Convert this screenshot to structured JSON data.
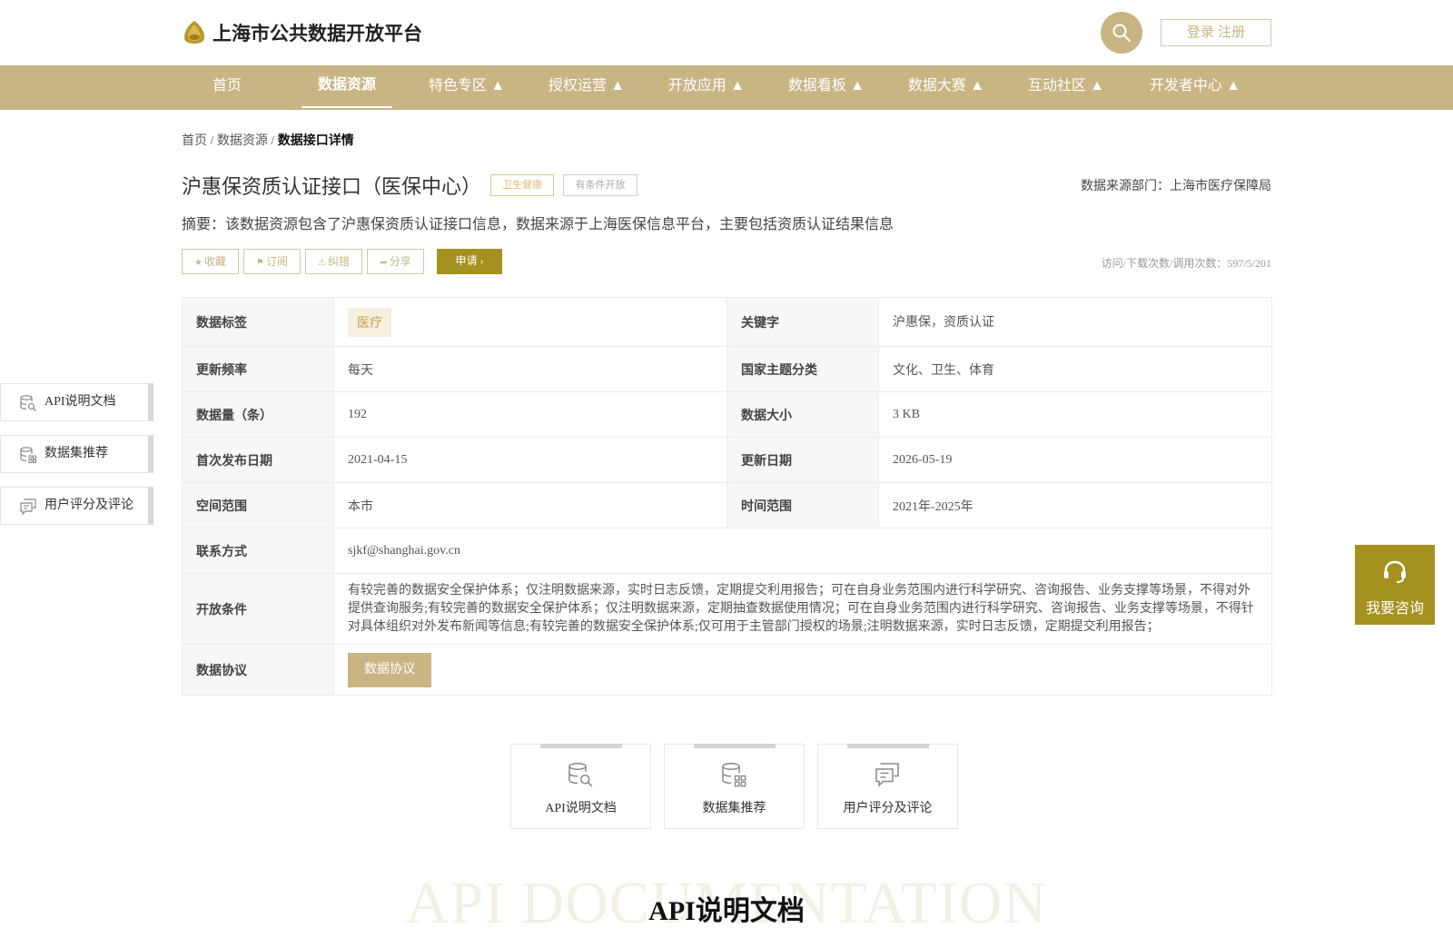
{
  "header": {
    "site_title": "上海市公共数据开放平台",
    "login_register": "登录 注册",
    "colors": {
      "accent": "#c9b484",
      "dark_accent": "#a5911f"
    }
  },
  "nav": [
    "首页",
    "数据资源",
    "特色专区 ▲",
    "授权运营 ▲",
    "开放应用 ▲",
    "数据看板 ▲",
    "数据大赛 ▲",
    "互动社区 ▲",
    "开发者中心 ▲"
  ],
  "breadcrumb": {
    "home": "首页",
    "sep1": " / ",
    "resource": "数据资源",
    "sep2": " / ",
    "current": "数据接口详情"
  },
  "detail": {
    "title": "沪惠保资质认证接口（医保中心）",
    "tag_category": "卫生健康",
    "tag_open_type": "有条件开放",
    "source": "数据来源部门：上海市医疗保障局",
    "summary": "摘要：该数据资源包含了沪惠保资质认证接口信息，数据来源于上海医保信息平台，主要包括资质认证结果信息",
    "actions": {
      "favorite": "收藏",
      "subscribe": "订阅",
      "report_error": "纠错",
      "share": "分享",
      "apply": "申请"
    },
    "visits": "访问/下载次数/调用次数：597/5/201"
  },
  "info": {
    "data_tag_label": "数据标签",
    "data_tag_value": "医疗",
    "keyword_label": "关键字",
    "keyword_value": "沪惠保，资质认证",
    "frequency_label": "更新频率",
    "frequency_value": "每天",
    "national_topic_label": "国家主题分类",
    "national_topic_value": "文化、卫生、体育",
    "volume_label": "数据量（条）",
    "volume_value": "192",
    "size_label": "数据大小",
    "size_value": "3 KB",
    "first_publish_label": "首次发布日期",
    "first_publish_value": "2021-04-15",
    "update_date_label": "更新日期",
    "update_date_value": "2026-05-19",
    "spatial_label": "空间范围",
    "spatial_value": "本市",
    "time_range_label": "时间范围",
    "time_range_value": "2021年-2025年",
    "contact_label": "联系方式",
    "contact_value": "sjkf@shanghai.gov.cn",
    "conditions_label": "开放条件",
    "conditions_value": "有较完善的数据安全保护体系；仅注明数据来源，实时日志反馈，定期提交利用报告；可在自身业务范围内进行科学研究、咨询报告、业务支撑等场景，不得对外提供查询服务;有较完善的数据安全保护体系；仅注明数据来源，定期抽查数据使用情况；可在自身业务范围内进行科学研究、咨询报告、业务支撑等场景，不得针对具体组织对外发布新闻等信息;有较完善的数据安全保护体系;仅可用于主管部门授权的场景;注明数据来源，实时日志反馈，定期提交利用报告；",
    "agreement_label": "数据协议",
    "agreement_button": "数据协议"
  },
  "sidebar": [
    "API说明文档",
    "数据集推荐",
    "用户评分及评论"
  ],
  "consult": "我要咨询",
  "cards": [
    "API说明文档",
    "数据集推荐",
    "用户评分及评论"
  ],
  "section": {
    "watermark": "API DOCUMENTATION",
    "title": "API说明文档"
  }
}
